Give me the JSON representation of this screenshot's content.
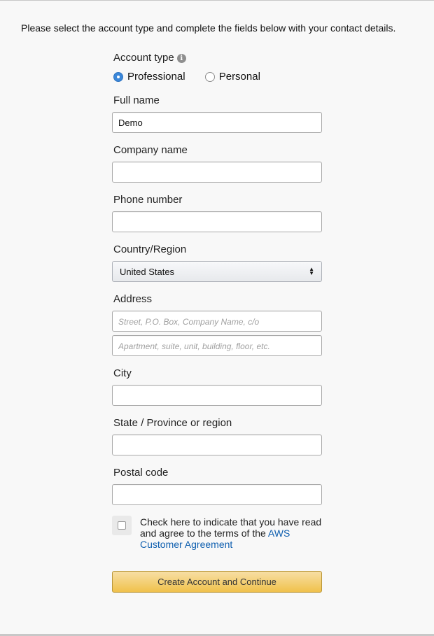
{
  "intro_text": "Please select the account type and complete the fields below with your contact details.",
  "account_type": {
    "label": "Account type",
    "info_glyph": "i",
    "options": [
      {
        "label": "Professional",
        "checked": true
      },
      {
        "label": "Personal",
        "checked": false
      }
    ]
  },
  "full_name": {
    "label": "Full name",
    "value": "Demo"
  },
  "company_name": {
    "label": "Company name",
    "value": ""
  },
  "phone_number": {
    "label": "Phone number",
    "value": ""
  },
  "country": {
    "label": "Country/Region",
    "selected": "United States"
  },
  "address": {
    "label": "Address",
    "line1_placeholder": "Street, P.O. Box, Company Name, c/o",
    "line2_placeholder": "Apartment, suite, unit, building, floor, etc."
  },
  "city": {
    "label": "City",
    "value": ""
  },
  "state": {
    "label": "State / Province or region",
    "value": ""
  },
  "postal_code": {
    "label": "Postal code",
    "value": ""
  },
  "agreement": {
    "text": "Check here to indicate that you have read and agree to the terms of the ",
    "link_text": "AWS Customer Agreement",
    "checked": false
  },
  "submit_label": "Create Account and Continue",
  "colors": {
    "radio_selected": "#3b87d9",
    "link": "#0f5faf",
    "button_top": "#f7dfa5",
    "button_bottom": "#f0c14b"
  },
  "icons": {
    "info": "info-icon",
    "select_arrows": "select-arrows-icon"
  }
}
